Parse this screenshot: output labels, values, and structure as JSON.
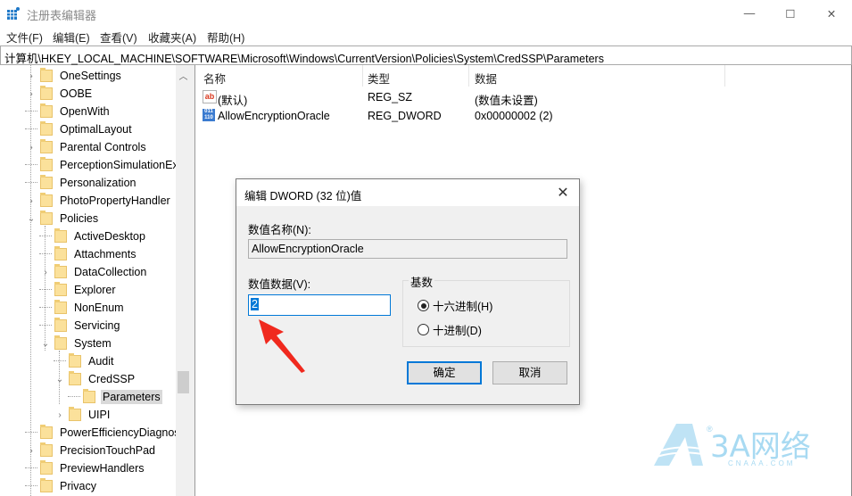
{
  "window": {
    "title": "注册表编辑器",
    "controls": {
      "minimize": "—",
      "maximize": "☐",
      "close": "✕"
    }
  },
  "menu": [
    "文件(F)",
    "编辑(E)",
    "查看(V)",
    "收藏夹(A)",
    "帮助(H)"
  ],
  "address": "计算机\\HKEY_LOCAL_MACHINE\\SOFTWARE\\Microsoft\\Windows\\CurrentVersion\\Policies\\System\\CredSSP\\Parameters",
  "tree": {
    "items": [
      {
        "label": "OneSettings",
        "level": 0,
        "expander": "collapsed"
      },
      {
        "label": "OOBE",
        "level": 0,
        "expander": "collapsed"
      },
      {
        "label": "OpenWith",
        "level": 0,
        "expander": "none"
      },
      {
        "label": "OptimalLayout",
        "level": 0,
        "expander": "none"
      },
      {
        "label": "Parental Controls",
        "level": 0,
        "expander": "collapsed"
      },
      {
        "label": "PerceptionSimulationEx",
        "level": 0,
        "expander": "none"
      },
      {
        "label": "Personalization",
        "level": 0,
        "expander": "none"
      },
      {
        "label": "PhotoPropertyHandler",
        "level": 0,
        "expander": "collapsed"
      },
      {
        "label": "Policies",
        "level": 0,
        "expander": "expanded"
      },
      {
        "label": "ActiveDesktop",
        "level": 1,
        "expander": "none"
      },
      {
        "label": "Attachments",
        "level": 1,
        "expander": "none"
      },
      {
        "label": "DataCollection",
        "level": 1,
        "expander": "collapsed"
      },
      {
        "label": "Explorer",
        "level": 1,
        "expander": "none"
      },
      {
        "label": "NonEnum",
        "level": 1,
        "expander": "none"
      },
      {
        "label": "Servicing",
        "level": 1,
        "expander": "none"
      },
      {
        "label": "System",
        "level": 1,
        "expander": "expanded"
      },
      {
        "label": "Audit",
        "level": 2,
        "expander": "none"
      },
      {
        "label": "CredSSP",
        "level": 2,
        "expander": "expanded"
      },
      {
        "label": "Parameters",
        "level": 3,
        "expander": "none",
        "selected": true
      },
      {
        "label": "UIPI",
        "level": 2,
        "expander": "collapsed"
      },
      {
        "label": "PowerEfficiencyDiagnos",
        "level": 0,
        "expander": "none"
      },
      {
        "label": "PrecisionTouchPad",
        "level": 0,
        "expander": "collapsed"
      },
      {
        "label": "PreviewHandlers",
        "level": 0,
        "expander": "none"
      },
      {
        "label": "Privacy",
        "level": 0,
        "expander": "none"
      }
    ]
  },
  "list": {
    "columns": [
      "名称",
      "类型",
      "数据"
    ],
    "rows": [
      {
        "icon": "string-value-icon",
        "name": "(默认)",
        "type": "REG_SZ",
        "data": "(数值未设置)"
      },
      {
        "icon": "binary-value-icon",
        "name": "AllowEncryptionOracle",
        "type": "REG_DWORD",
        "data": "0x00000002 (2)"
      }
    ]
  },
  "dialog": {
    "title": "编辑 DWORD (32 位)值",
    "value_name_label": "数值名称(N):",
    "value_name": "AllowEncryptionOracle",
    "value_data_label": "数值数据(V):",
    "value_data": "2",
    "base_label": "基数",
    "base_options": [
      {
        "label": "十六进制(H)",
        "checked": true
      },
      {
        "label": "十进制(D)",
        "checked": false
      }
    ],
    "ok_label": "确定",
    "cancel_label": "取消"
  },
  "watermark": {
    "brand": "3A网络",
    "site": "CNAAA.COM",
    "mark": "®"
  },
  "colors": {
    "accent": "#0078d7",
    "annotation_arrow": "#f0291e",
    "folder": "#fbe19b"
  }
}
